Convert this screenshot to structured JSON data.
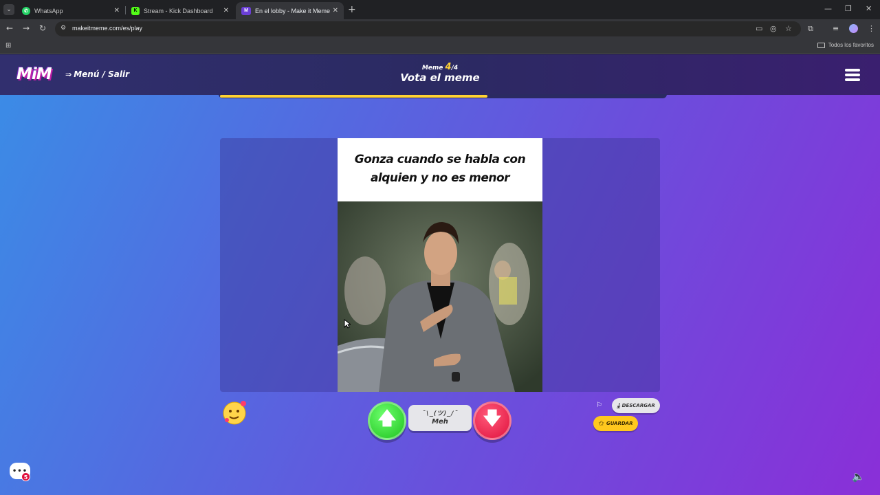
{
  "browser": {
    "tabs": [
      {
        "title": "WhatsApp",
        "active": false
      },
      {
        "title": "Stream - Kick Dashboard",
        "active": false
      },
      {
        "title": "En el lobby - Make it Meme",
        "active": true
      }
    ],
    "url": "makeitmeme.com/es/play",
    "bookmarks_label": "Todos los favoritos"
  },
  "header": {
    "logo": "MiM",
    "menu_exit": "Menú / Salir",
    "round_prefix": "Meme",
    "round_current": "4",
    "round_total": "/4",
    "title": "Vota el meme"
  },
  "progress": {
    "fraction": 0.6
  },
  "meme": {
    "caption": "Gonza cuando se habla con alquien y no es menor"
  },
  "vote": {
    "meh_face": "¯\\_(ツ)_/¯",
    "meh_label": "Meh"
  },
  "actions": {
    "download_label": "DESCARGAR",
    "save_label": "GUARDAR"
  },
  "chat": {
    "bubble_text": "•••",
    "badge_count": "5"
  },
  "colors": {
    "accent_yellow": "#ffd233",
    "vote_up": "#1ec21e",
    "vote_down": "#e0113d"
  }
}
